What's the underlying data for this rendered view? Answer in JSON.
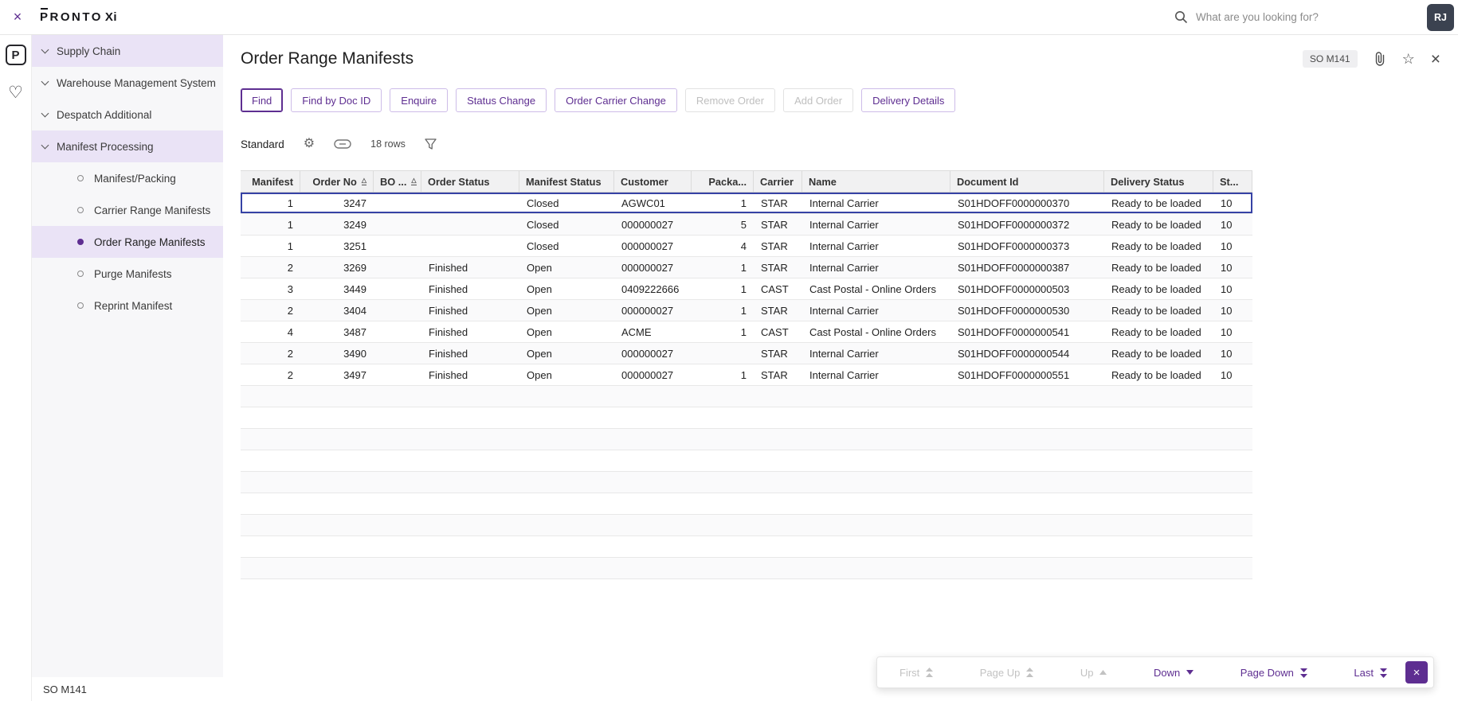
{
  "colors": {
    "accent": "#5E2E91",
    "selection": "#3642A5"
  },
  "icons": {
    "close": "×",
    "gear": "⚙",
    "star": "☆",
    "heart": "♡",
    "sort": "△"
  },
  "topbar": {
    "close": "×",
    "brand": "PRONTO",
    "brand_suffix": "Xi",
    "search_placeholder": "What are you looking for?",
    "avatar": "RJ"
  },
  "rail": {
    "logo": "P"
  },
  "sidebar": {
    "items": [
      {
        "label": "Supply Chain",
        "highlight": true
      },
      {
        "label": "Warehouse Management System",
        "highlight": false
      },
      {
        "label": "Despatch Additional",
        "highlight": false
      },
      {
        "label": "Manifest Processing",
        "highlight": true,
        "children": [
          {
            "label": "Manifest/Packing",
            "selected": false
          },
          {
            "label": "Carrier Range Manifests",
            "selected": false
          },
          {
            "label": "Order Range Manifests",
            "selected": true
          },
          {
            "label": "Purge Manifests",
            "selected": false
          },
          {
            "label": "Reprint Manifest",
            "selected": false
          }
        ]
      }
    ],
    "footer": "SO M141"
  },
  "main": {
    "title": "Order Range Manifests",
    "badge": "SO M141",
    "toolbar": [
      {
        "label": "Find",
        "state": "active"
      },
      {
        "label": "Find by Doc ID",
        "state": "normal"
      },
      {
        "label": "Enquire",
        "state": "normal"
      },
      {
        "label": "Status Change",
        "state": "normal"
      },
      {
        "label": "Order Carrier Change",
        "state": "normal"
      },
      {
        "label": "Remove Order",
        "state": "disabled"
      },
      {
        "label": "Add Order",
        "state": "disabled"
      },
      {
        "label": "Delivery Details",
        "state": "normal"
      }
    ],
    "grid_toolbar": {
      "view": "Standard",
      "rows_label": "18 rows"
    }
  },
  "table": {
    "columns": [
      "Manifest",
      "Order No",
      "BO ...",
      "Order Status",
      "Manifest Status",
      "Customer",
      "Packa...",
      "Carrier",
      "Name",
      "Document Id",
      "Delivery Status",
      "St..."
    ],
    "selected_row": 0,
    "rows": [
      [
        "1",
        "3247",
        "",
        "",
        "Closed",
        "AGWC01",
        "1",
        "STAR",
        "Internal Carrier",
        "S01HDOFF0000000370",
        "Ready to be loaded",
        "10"
      ],
      [
        "1",
        "3249",
        "",
        "",
        "Closed",
        "000000027",
        "5",
        "STAR",
        "Internal Carrier",
        "S01HDOFF0000000372",
        "Ready to be loaded",
        "10"
      ],
      [
        "1",
        "3251",
        "",
        "",
        "Closed",
        "000000027",
        "4",
        "STAR",
        "Internal Carrier",
        "S01HDOFF0000000373",
        "Ready to be loaded",
        "10"
      ],
      [
        "2",
        "3269",
        "",
        "Finished",
        "Open",
        "000000027",
        "1",
        "STAR",
        "Internal Carrier",
        "S01HDOFF0000000387",
        "Ready to be loaded",
        "10"
      ],
      [
        "3",
        "3449",
        "",
        "Finished",
        "Open",
        "0409222666",
        "1",
        "CAST",
        "Cast Postal - Online Orders",
        "S01HDOFF0000000503",
        "Ready to be loaded",
        "10"
      ],
      [
        "2",
        "3404",
        "",
        "Finished",
        "Open",
        "000000027",
        "1",
        "STAR",
        "Internal Carrier",
        "S01HDOFF0000000530",
        "Ready to be loaded",
        "10"
      ],
      [
        "4",
        "3487",
        "",
        "Finished",
        "Open",
        "ACME",
        "1",
        "CAST",
        "Cast Postal - Online Orders",
        "S01HDOFF0000000541",
        "Ready to be loaded",
        "10"
      ],
      [
        "2",
        "3490",
        "",
        "Finished",
        "Open",
        "000000027",
        "",
        "STAR",
        "Internal Carrier",
        "S01HDOFF0000000544",
        "Ready to be loaded",
        "10"
      ],
      [
        "2",
        "3497",
        "",
        "Finished",
        "Open",
        "000000027",
        "1",
        "STAR",
        "Internal Carrier",
        "S01HDOFF0000000551",
        "Ready to be loaded",
        "10"
      ]
    ]
  },
  "pagination": {
    "buttons": [
      {
        "label": "First",
        "icon": "double-up",
        "disabled": true
      },
      {
        "label": "Page Up",
        "icon": "double-up",
        "disabled": true
      },
      {
        "label": "Up",
        "icon": "up",
        "disabled": true
      },
      {
        "label": "Down",
        "icon": "down",
        "disabled": false
      },
      {
        "label": "Page Down",
        "icon": "double-down",
        "disabled": false
      },
      {
        "label": "Last",
        "icon": "double-down",
        "disabled": false
      }
    ],
    "close": "×"
  }
}
